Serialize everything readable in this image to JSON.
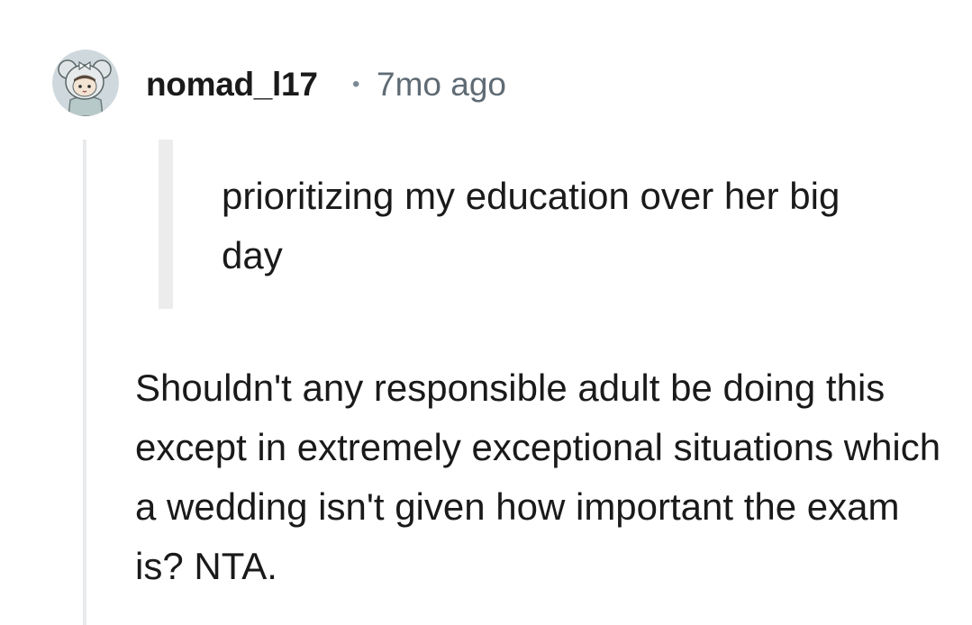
{
  "comment": {
    "author": "nomad_l17",
    "separator": "•",
    "time": "7mo ago",
    "quote": "prioritizing my education over her big day",
    "body": "Shouldn't any responsible adult be doing this except in extremely exceptional situations which a wedding isn't given how important the exam is? NTA.",
    "avatar_icon": "koala-avatar-icon",
    "colors": {
      "author": "#1a1a1b",
      "time": "#5f6b74",
      "quote_bar": "#ececec",
      "thread_line": "#e8eaec",
      "avatar_bg": "#cfd8dc"
    }
  }
}
